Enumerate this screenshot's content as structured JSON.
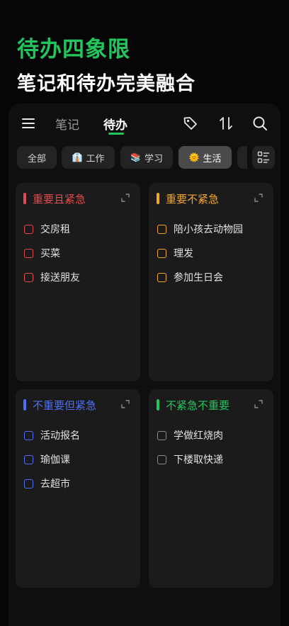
{
  "hero": {
    "title": "待办四象限",
    "subtitle": "笔记和待办完美融合"
  },
  "nav": {
    "tabs": [
      {
        "label": "笔记",
        "active": false
      },
      {
        "label": "待办",
        "active": true
      }
    ],
    "icons": [
      "menu-icon",
      "tag-icon",
      "sort-icon",
      "search-icon"
    ]
  },
  "filters": [
    {
      "emoji": "",
      "label": "全部",
      "active": false
    },
    {
      "emoji": "👔",
      "label": "工作",
      "active": false
    },
    {
      "emoji": "📚",
      "label": "学习",
      "active": false
    },
    {
      "emoji": "🌞",
      "label": "生活",
      "active": true
    }
  ],
  "quadrants": [
    {
      "title": "重要且紧急",
      "color": "#e5484d",
      "tasks": [
        "交房租",
        "买菜",
        "接送朋友"
      ]
    },
    {
      "title": "重要不紧急",
      "color": "#f5a623",
      "tasks": [
        "陪小孩去动物园",
        "理发",
        "参加生日会"
      ]
    },
    {
      "title": "不重要但紧急",
      "color": "#4f6ef7",
      "tasks": [
        "活动报名",
        "瑜伽课",
        "去超市"
      ]
    },
    {
      "title": "不紧急不重要",
      "color": "#22c55e",
      "task_checkbox_color": "#8a8a8a",
      "tasks": [
        "学做红烧肉",
        "下楼取快递"
      ]
    }
  ]
}
